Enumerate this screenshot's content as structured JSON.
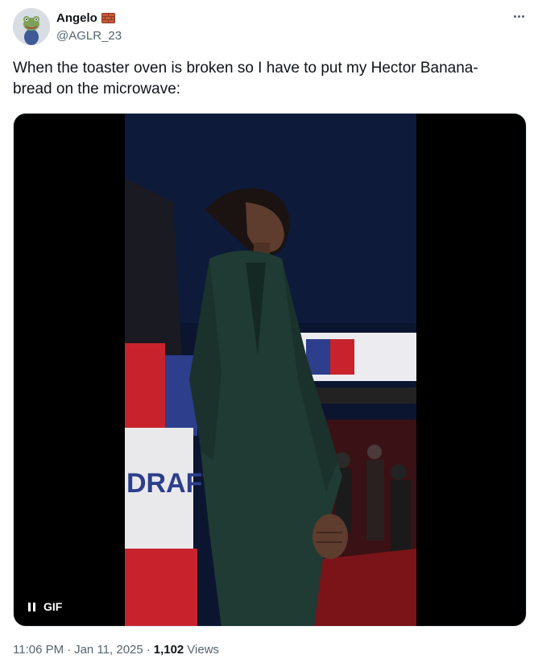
{
  "author": {
    "display_name": "Angelo",
    "handle": "@AGLR_23",
    "badge_icon": "brick-icon",
    "avatar_icon": "frog-avatar"
  },
  "more_icon": "more-icon",
  "tweet": {
    "text": "When the toaster oven is broken so I have to put my Hector Banana-\nbread on the microwave:"
  },
  "media": {
    "type": "GIF",
    "badge_label": "GIF",
    "pause_icon": "pause-icon",
    "backdrop_text": "DRAFT 2"
  },
  "meta": {
    "time": "11:06 PM",
    "separator": "·",
    "date": "Jan 11, 2025",
    "views_count": "1,102",
    "views_label": "Views"
  },
  "colors": {
    "text_primary": "#0f1419",
    "text_secondary": "#536471",
    "suit_green": "#1f3b33",
    "draft_red": "#c8232c",
    "draft_blue": "#2d3e8c"
  }
}
